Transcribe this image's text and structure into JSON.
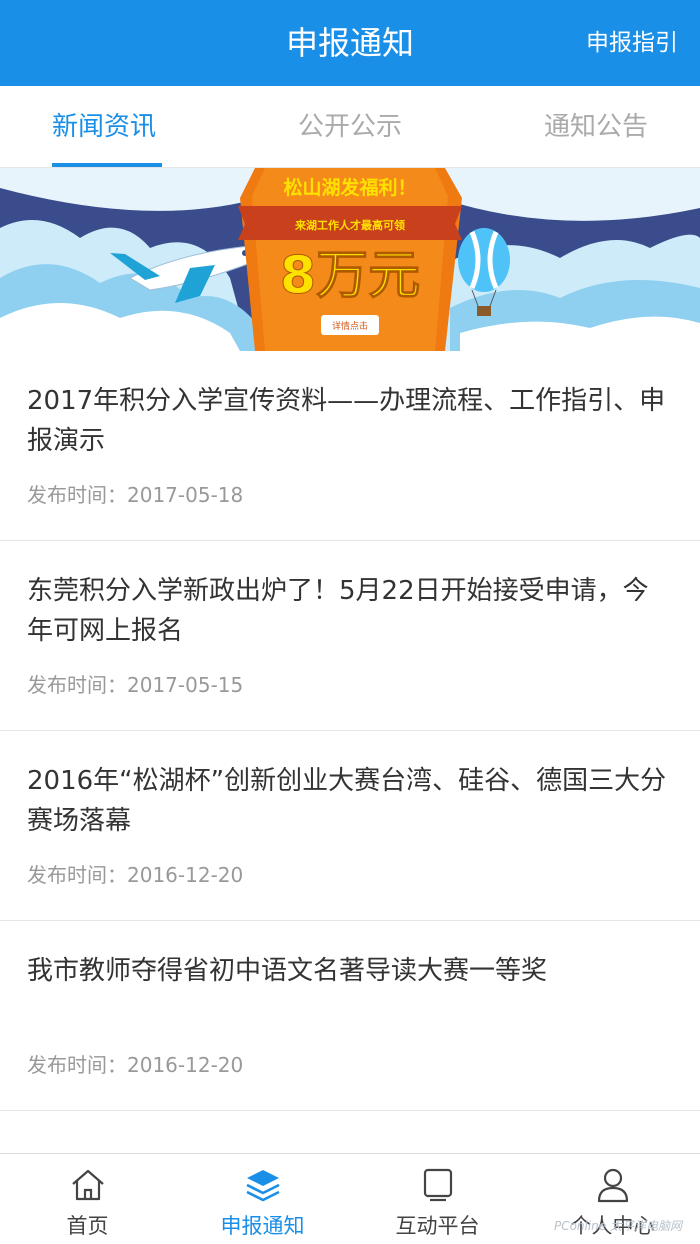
{
  "header": {
    "title": "申报通知",
    "action_label": "申报指引"
  },
  "tabs": [
    {
      "label": "新闻资讯",
      "active": true
    },
    {
      "label": "公开公示",
      "active": false
    },
    {
      "label": "通知公告",
      "active": false
    }
  ],
  "banner": {
    "headline": "松山湖发福利！",
    "subline": "来湖工作人才最高可领",
    "amount": "8万元",
    "button_label": "详情点击"
  },
  "news": [
    {
      "title": "2017年积分入学宣传资料——办理流程、工作指引、申报演示",
      "date": "发布时间：2017-05-18"
    },
    {
      "title": "东莞积分入学新政出炉了！5月22日开始接受申请，今年可网上报名",
      "date": "发布时间：2017-05-15"
    },
    {
      "title": "2016年“松湖杯”创新创业大赛台湾、硅谷、德国三大分赛场落幕",
      "date": "发布时间：2016-12-20"
    },
    {
      "title": "我市教师夺得省初中语文名著导读大赛一等奖",
      "date": "发布时间：2016-12-20"
    }
  ],
  "tabbar": [
    {
      "label": "首页",
      "icon": "home-icon",
      "active": false
    },
    {
      "label": "申报通知",
      "icon": "layers-icon",
      "active": true
    },
    {
      "label": "互动平台",
      "icon": "screen-icon",
      "active": false
    },
    {
      "label": "个人中心",
      "icon": "user-icon",
      "active": false
    }
  ],
  "watermark": "PConline 太平洋电脑网",
  "colors": {
    "accent": "#1a8fe8",
    "banner_bg": "#3a4c8c",
    "banner_orange": "#f07a12",
    "amount_yellow": "#ffe100"
  }
}
